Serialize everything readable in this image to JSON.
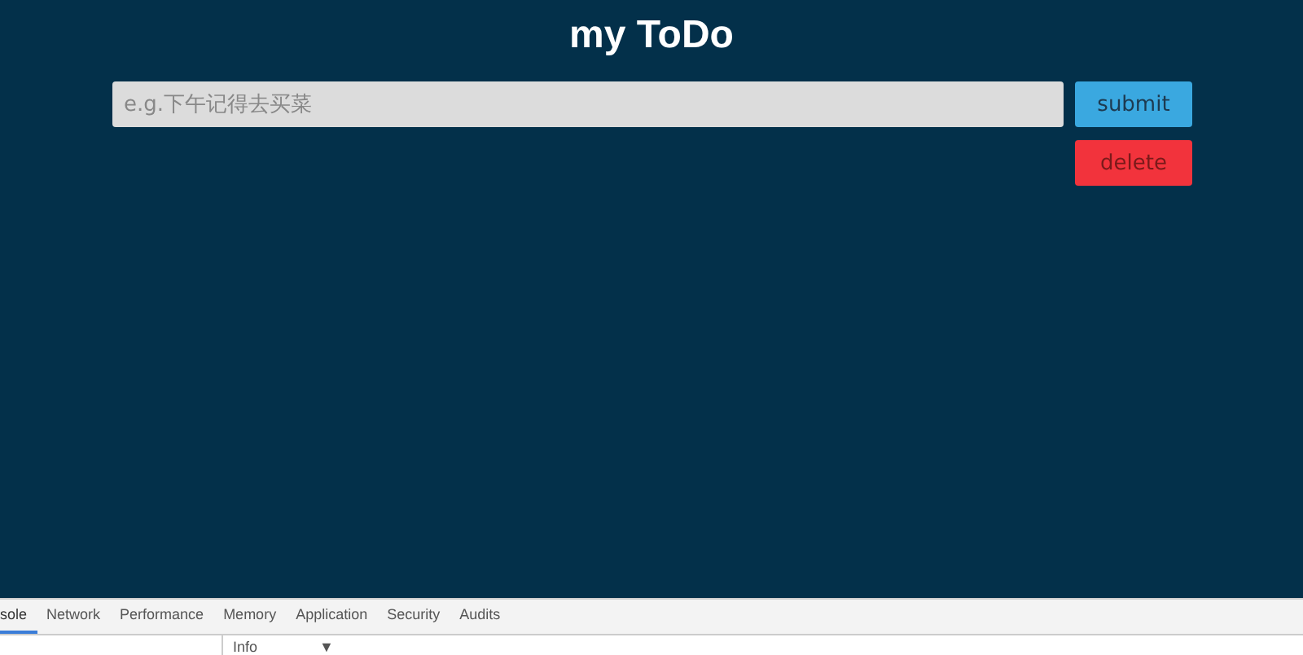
{
  "app": {
    "title": "my ToDo",
    "input": {
      "placeholder": "e.g.下午记得去买菜"
    },
    "buttons": [
      "submit",
      "delete"
    ]
  },
  "devtools": {
    "tabs": [
      {
        "label": "sole",
        "selected": true
      },
      {
        "label": "Network",
        "selected": false
      },
      {
        "label": "Performance",
        "selected": false
      },
      {
        "label": "Memory",
        "selected": false
      },
      {
        "label": "Application",
        "selected": false
      },
      {
        "label": "Security",
        "selected": false
      },
      {
        "label": "Audits",
        "selected": false
      }
    ],
    "level_dropdown": {
      "value": "Info",
      "caret": "▼"
    }
  }
}
